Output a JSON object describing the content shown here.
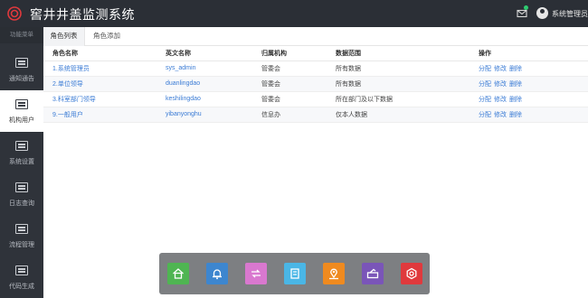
{
  "header": {
    "title": "窖井井盖监测系统",
    "user_name": "系统管理员"
  },
  "sidebar": {
    "head": "功能菜单",
    "items": [
      {
        "label": "通知通告"
      },
      {
        "label": "机构用户"
      },
      {
        "label": "系统设置"
      },
      {
        "label": "日志查询"
      },
      {
        "label": "流程管理"
      },
      {
        "label": "代码生成"
      }
    ]
  },
  "tabs": [
    {
      "label": "角色列表"
    },
    {
      "label": "角色添加"
    }
  ],
  "table": {
    "headers": [
      "角色名称",
      "英文名称",
      "归属机构",
      "数据范围",
      "操作"
    ],
    "rows": [
      {
        "name": "1.系统管理员",
        "en": "sys_admin",
        "org": "管委会",
        "scope": "所有数据"
      },
      {
        "name": "2.单位领导",
        "en": "duanlingdao",
        "org": "管委会",
        "scope": "所有数据"
      },
      {
        "name": "3.科室部门领导",
        "en": "keshilingdao",
        "org": "管委会",
        "scope": "所在部门及以下数据"
      },
      {
        "name": "9.一般用户",
        "en": "yibanyonghu",
        "org": "信息办",
        "scope": "仅本人数据"
      }
    ],
    "actions": {
      "assign": "分配",
      "edit": "修改",
      "delete": "删除"
    }
  },
  "dock": {
    "items": [
      {
        "icon": "home-icon",
        "color": "#4fb552"
      },
      {
        "icon": "alarm-bell-icon",
        "color": "#3d86cf"
      },
      {
        "icon": "transfer-icon",
        "color": "#d978cf"
      },
      {
        "icon": "device-icon",
        "color": "#4ab6e6"
      },
      {
        "icon": "map-pin-icon",
        "color": "#ef8a1f"
      },
      {
        "icon": "cover-icon",
        "color": "#7a55b8"
      },
      {
        "icon": "settings-icon",
        "color": "#e0393d"
      }
    ]
  }
}
